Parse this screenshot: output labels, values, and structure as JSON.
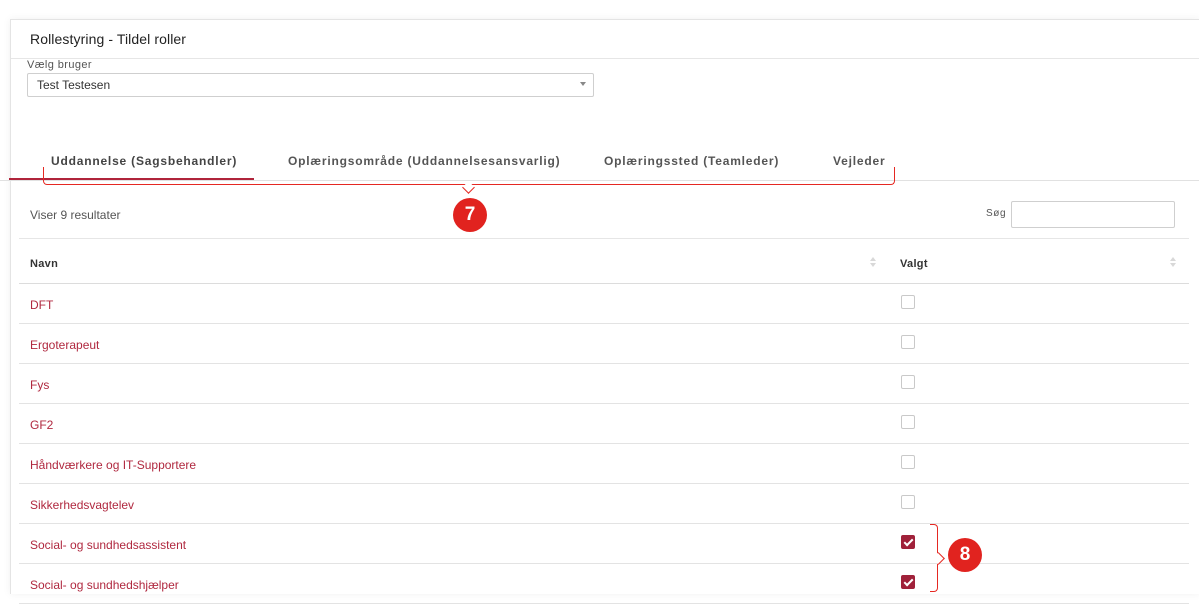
{
  "panel": {
    "title": "Rollestyring - Tildel roller"
  },
  "user_select": {
    "label": "Vælg bruger",
    "value": "Test Testesen"
  },
  "tabs": [
    {
      "label": "Uddannelse (Sagsbehandler)",
      "active": true
    },
    {
      "label": "Oplæringsområde (Uddannelsesansvarlig)",
      "active": false
    },
    {
      "label": "Oplæringssted (Teamleder)",
      "active": false
    },
    {
      "label": "Vejleder",
      "active": false
    }
  ],
  "results": {
    "count_text": "Viser 9 resultater"
  },
  "search": {
    "label": "Søg",
    "value": ""
  },
  "table": {
    "columns": [
      "Navn",
      "Valgt"
    ],
    "rows": [
      {
        "name": "DFT",
        "checked": false
      },
      {
        "name": "Ergoterapeut",
        "checked": false
      },
      {
        "name": "Fys",
        "checked": false
      },
      {
        "name": "GF2",
        "checked": false
      },
      {
        "name": "Håndværkere og IT-Supportere",
        "checked": false
      },
      {
        "name": "Sikkerhedsvagtelev",
        "checked": false
      },
      {
        "name": "Social- og sundhedsassistent",
        "checked": true
      },
      {
        "name": "Social- og sundhedshjælper",
        "checked": true
      }
    ]
  },
  "annotations": {
    "callout_tabs": "7",
    "callout_rows": "8"
  },
  "colors": {
    "accent": "#b0243b",
    "link": "#b0283f",
    "annotation": "#e1231f"
  }
}
